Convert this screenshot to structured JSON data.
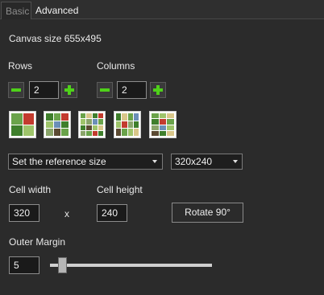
{
  "tabs": {
    "basic": "Basic",
    "advanced": "Advanced"
  },
  "canvas": {
    "text": "Canvas size 655x495"
  },
  "rows": {
    "label": "Rows",
    "value": "2"
  },
  "columns": {
    "label": "Columns",
    "value": "2"
  },
  "layout_presets": [
    "2x2",
    "3x3",
    "4x4",
    "3x4",
    "4x3"
  ],
  "reference": {
    "mode": "Set the reference size",
    "size": "320x240"
  },
  "cell": {
    "width_label": "Cell width",
    "width_value": "320",
    "separator": "x",
    "height_label": "Cell height",
    "height_value": "240",
    "rotate_label": "Rotate 90°"
  },
  "margin": {
    "label": "Outer Margin",
    "value": "5",
    "slider_fraction": 0.05
  },
  "colors": {
    "accent_green": "#4fd11a",
    "background": "#2b2b2b"
  }
}
